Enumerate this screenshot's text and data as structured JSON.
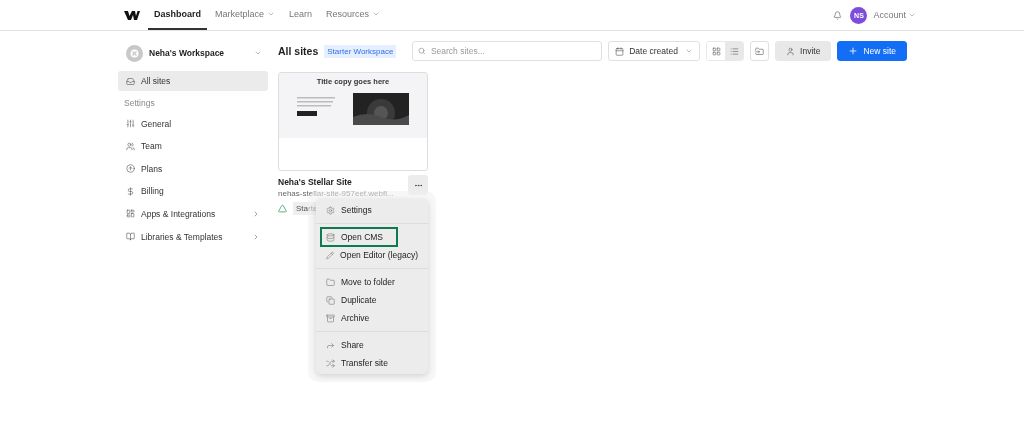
{
  "nav": {
    "tabs": [
      {
        "label": "Dashboard",
        "selected": true,
        "caret": false
      },
      {
        "label": "Marketplace",
        "selected": false,
        "caret": true
      },
      {
        "label": "Learn",
        "selected": false,
        "caret": false
      },
      {
        "label": "Resources",
        "selected": false,
        "caret": true
      }
    ],
    "avatar": "NS",
    "account": "Account"
  },
  "sidebar": {
    "workspace": "Neha's Workspace",
    "items": [
      {
        "label": "All sites",
        "selected": true,
        "chevron": false
      }
    ],
    "section": "Settings",
    "settings": [
      {
        "label": "General",
        "selected": false,
        "chevron": false
      },
      {
        "label": "Team",
        "selected": false,
        "chevron": false
      },
      {
        "label": "Plans",
        "selected": false,
        "chevron": false
      },
      {
        "label": "Billing",
        "selected": false,
        "chevron": false
      },
      {
        "label": "Apps & Integrations",
        "selected": false,
        "chevron": true
      },
      {
        "label": "Libraries & Templates",
        "selected": false,
        "chevron": true
      }
    ]
  },
  "toolbar": {
    "title": "All sites",
    "badge": "Starter Workspace",
    "search": {
      "placeholder": "Search sites..."
    },
    "sort": "Date created",
    "view": [
      {
        "kind": "grid",
        "selected": false
      },
      {
        "kind": "list",
        "selected": true
      }
    ],
    "invite": "Invite",
    "new_site": "New site"
  },
  "site": {
    "preview_title": "Title copy goes here",
    "name": "Neha's Stellar Site",
    "url": "nehas-stellar-site-957eef.webfl...",
    "plan": "Starte"
  },
  "menu": [
    [
      {
        "label": "Settings",
        "highlighted": false
      }
    ],
    [
      {
        "label": "Open CMS",
        "highlighted": true
      },
      {
        "label": "Open Editor (legacy)",
        "highlighted": false
      }
    ],
    [
      {
        "label": "Move to folder",
        "highlighted": false
      },
      {
        "label": "Duplicate",
        "highlighted": false
      },
      {
        "label": "Archive",
        "highlighted": false
      }
    ],
    [
      {
        "label": "Share",
        "highlighted": false
      },
      {
        "label": "Transfer site",
        "highlighted": false
      }
    ]
  ]
}
